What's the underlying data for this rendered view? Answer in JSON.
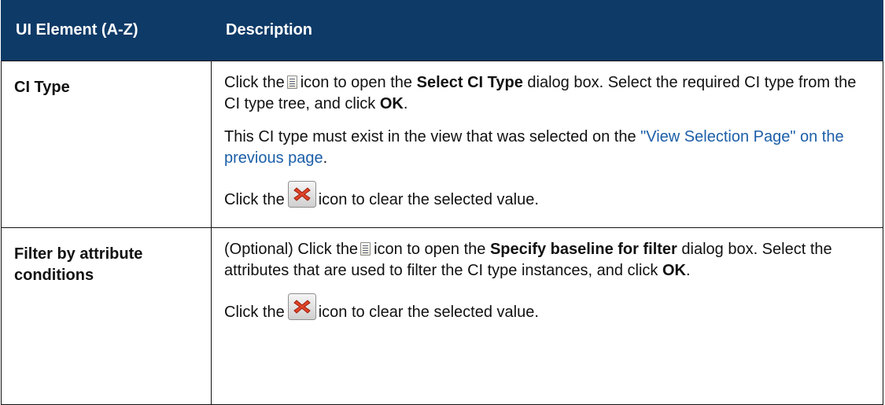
{
  "table": {
    "headers": {
      "element": "UI Element (A-Z)",
      "description": "Description"
    },
    "rows": [
      {
        "element": "CI Type",
        "p1": {
          "t1": "Click the",
          "t2": "icon to open the",
          "b1": "Select CI Type",
          "t3": "dialog box. Select the required CI type from the CI type tree, and click",
          "b2": "OK",
          "t4": "."
        },
        "p2": {
          "t1": "This CI type must exist in the view that was selected on the",
          "link": "\"View Selection Page\" on the previous page",
          "t2": "."
        },
        "p3": {
          "t1": "Click the",
          "t2": "icon to clear the selected value."
        }
      },
      {
        "element": "Filter by attribute conditions",
        "p1": {
          "t1": "(Optional) Click the",
          "t2": "icon to open the",
          "b1": "Specify baseline for filter",
          "t3": "dialog box. Select the attributes that are used to filter the CI type instances, and click",
          "b2": "OK",
          "t4": "."
        },
        "p2": {
          "t1": "Click the",
          "t2": "icon to clear the selected value."
        }
      }
    ]
  },
  "icons": {
    "list": "list-icon",
    "clear": "clear-icon"
  },
  "colors": {
    "header_bg": "#0e3a67",
    "header_text": "#ffffff",
    "link": "#1c5fa8",
    "clear_icon_red": "#d93a25"
  }
}
